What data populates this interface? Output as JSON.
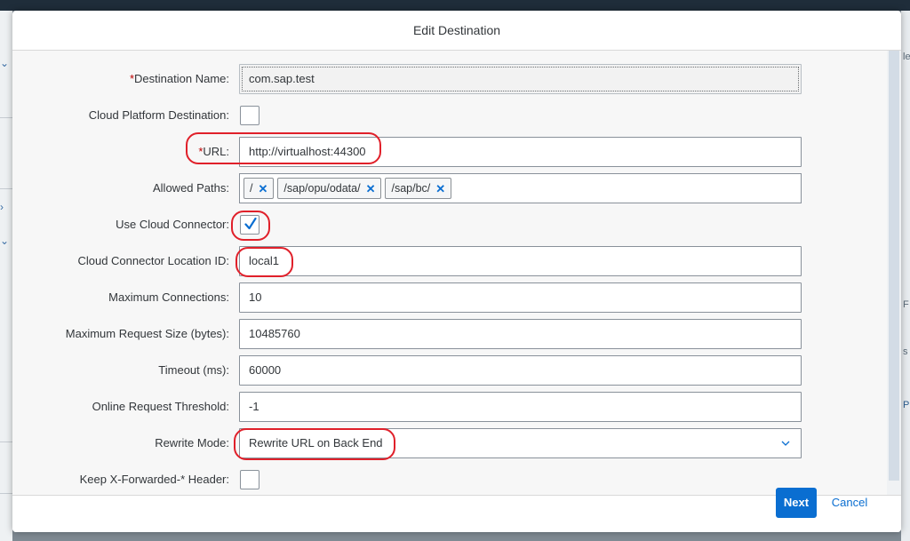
{
  "dialog": {
    "title": "Edit Destination"
  },
  "form": {
    "destination_name": {
      "label": "Destination Name:",
      "required_mark": "*",
      "value": "com.sap.test"
    },
    "cloud_platform_destination": {
      "label": "Cloud Platform Destination:",
      "checked": false
    },
    "url": {
      "label": "URL:",
      "required_mark": "*",
      "value": "http://virtualhost:44300"
    },
    "allowed_paths": {
      "label": "Allowed Paths:",
      "tokens": [
        "/",
        "/sap/opu/odata/",
        "/sap/bc/"
      ],
      "remove_glyph": "✕"
    },
    "use_cloud_connector": {
      "label": "Use Cloud Connector:",
      "checked": true
    },
    "cloud_connector_location_id": {
      "label": "Cloud Connector Location ID:",
      "value": "local1"
    },
    "maximum_connections": {
      "label": "Maximum Connections:",
      "value": "10"
    },
    "maximum_request_size": {
      "label": "Maximum Request Size (bytes):",
      "value": "10485760"
    },
    "timeout": {
      "label": "Timeout (ms):",
      "value": "60000"
    },
    "online_request_threshold": {
      "label": "Online Request Threshold:",
      "value": "-1"
    },
    "rewrite_mode": {
      "label": "Rewrite Mode:",
      "value": "Rewrite URL on Back End"
    },
    "keep_x_forwarded_header": {
      "label": "Keep X-Forwarded-* Header:",
      "checked": false
    }
  },
  "footer": {
    "next_label": "Next",
    "cancel_label": "Cancel"
  },
  "background": {
    "right_fragments": [
      "le",
      "F",
      "s",
      "P"
    ]
  },
  "colors": {
    "accent": "#0a6ed1",
    "required": "#bb0000",
    "annotation": "#e0202a"
  },
  "icons": {
    "checkmark": "checkmark-icon",
    "chevron": "chevron-down-icon",
    "token_remove": "close-icon"
  }
}
